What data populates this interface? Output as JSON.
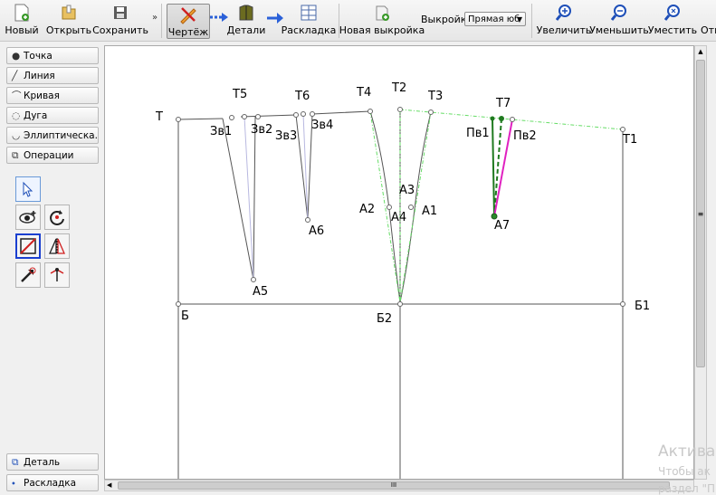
{
  "toolbar": {
    "new_label": "Новый",
    "open_label": "Открыть",
    "save_label": "Сохранить",
    "overflow": "»",
    "draft_label": "Чертёж",
    "details_label": "Детали",
    "layout_label": "Раскладка",
    "new_pattern_label": "Новая выкройка",
    "pattern_label": "Выкройка:",
    "pattern_value": "Прямая юб",
    "zoom_in_label": "Увеличить",
    "zoom_out_label": "Уменьшить",
    "fit_label": "Уместить",
    "cut_label": "Отм"
  },
  "sidebar": {
    "items": [
      {
        "label": "Точка",
        "icon": "point-icon"
      },
      {
        "label": "Линия",
        "icon": "line-icon"
      },
      {
        "label": "Кривая",
        "icon": "curve-icon"
      },
      {
        "label": "Дуга",
        "icon": "arc-icon"
      },
      {
        "label": "Эллиптическа...",
        "icon": "ellipse-icon"
      },
      {
        "label": "Операции",
        "icon": "operations-icon"
      }
    ],
    "bottom_items": [
      {
        "label": "Деталь",
        "icon": "detail-icon"
      },
      {
        "label": "Раскладка",
        "icon": "layout-icon"
      }
    ]
  },
  "points": {
    "T": "Т",
    "T1": "Т1",
    "T2": "Т2",
    "T3": "Т3",
    "T4": "Т4",
    "T5": "Т5",
    "T6": "Т6",
    "T7": "Т7",
    "B": "Б",
    "B1": "Б1",
    "B2": "Б2",
    "A1": "А1",
    "A2": "А2",
    "A3": "А3",
    "A4": "А4",
    "A5": "А5",
    "A6": "А6",
    "A7": "А7",
    "Zv1": "Зв1",
    "Zv2": "Зв2",
    "Zv3": "Зв3",
    "Zv4": "Зв4",
    "Pv1": "Пв1",
    "Pv2": "Пв2"
  },
  "scroll": {
    "h_thumb": "III",
    "v_thumb": "≡"
  },
  "watermark": {
    "line1": "Актива",
    "line2": "Чтобы ак",
    "line3": "раздел \"П"
  },
  "colors": {
    "accent": "#1a3fd0",
    "green": "#1f7a1f",
    "magenta": "#e020c0",
    "guide": "#66dd66"
  }
}
